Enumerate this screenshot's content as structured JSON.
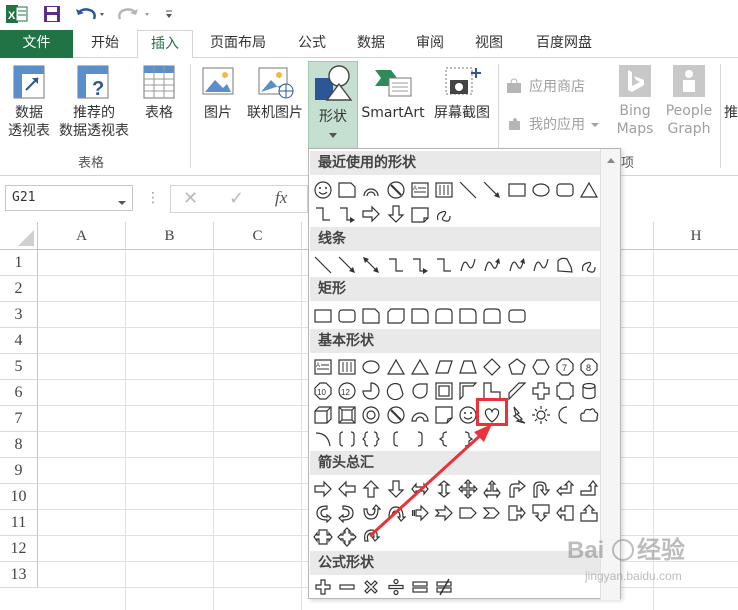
{
  "quick_access": {
    "icons": [
      "excel-logo-icon",
      "save-icon",
      "undo-icon",
      "redo-icon",
      "customize-qat-icon"
    ]
  },
  "tabs": [
    "文件",
    "开始",
    "插入",
    "页面布局",
    "公式",
    "数据",
    "审阅",
    "视图",
    "百度网盘"
  ],
  "active_tab": "插入",
  "ribbon": {
    "pivot_table": [
      "数据",
      "透视表"
    ],
    "recommended_pivot": [
      "推荐的",
      "数据透视表"
    ],
    "table": "表格",
    "group_tables": "表格",
    "picture": "图片",
    "online_picture": "联机图片",
    "shapes": "形状",
    "smartart": "SmartArt",
    "screenshot": "屏幕截图",
    "app_store": "应用商店",
    "my_apps": "我的应用",
    "bing_maps": [
      "Bing",
      "Maps"
    ],
    "people_graph": [
      "People",
      "Graph"
    ],
    "group_apps_partial": "项",
    "recommended_partial": "推"
  },
  "formula_bar": {
    "name_box": "G21",
    "fx": "fx"
  },
  "grid": {
    "columns": [
      "A",
      "B",
      "C",
      "H"
    ],
    "rows": [
      "1",
      "2",
      "3",
      "4",
      "5",
      "6",
      "7",
      "8",
      "9",
      "10",
      "11",
      "12",
      "13"
    ]
  },
  "shapes_menu": {
    "sections": [
      {
        "title": "最近使用的形状"
      },
      {
        "title": "线条"
      },
      {
        "title": "矩形"
      },
      {
        "title": "基本形状"
      },
      {
        "title": "箭头总汇"
      },
      {
        "title": "公式形状"
      }
    ],
    "highlighted_shape": "heart-shape",
    "accent": "#e8333b"
  },
  "watermark": {
    "brand": "Baidu经验",
    "url": "jingyan.baidu.com"
  },
  "colors": {
    "excel_green": "#217346",
    "annotation_red": "#e8333b"
  }
}
